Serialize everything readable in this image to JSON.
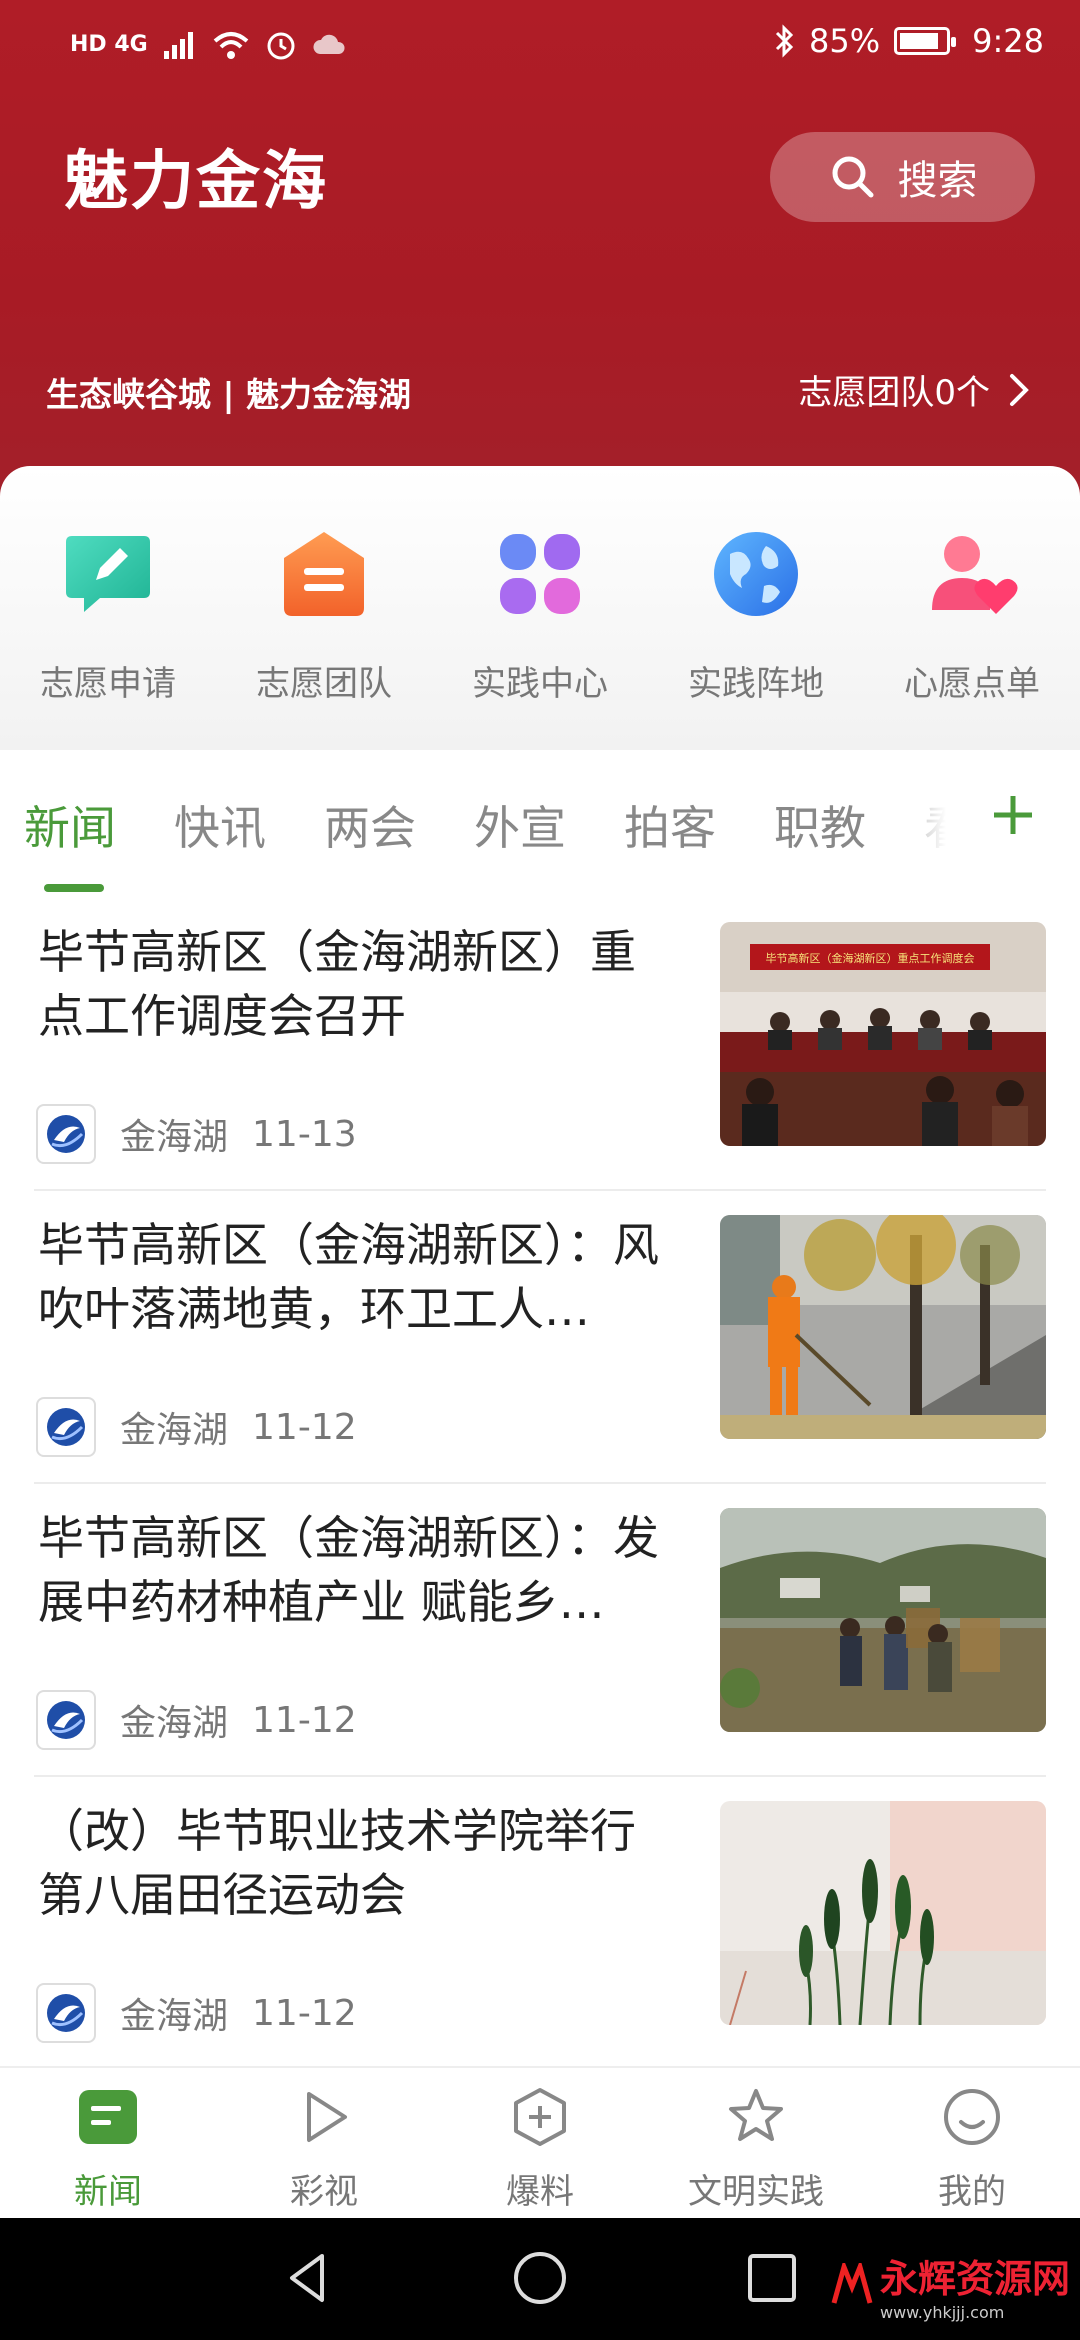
{
  "status_bar": {
    "network": "HD 4G",
    "battery": "85%",
    "battery_level": 0.85,
    "time": "9:28"
  },
  "header": {
    "title": "魅力金海",
    "search_label": "搜索",
    "slogan": "生态峡谷城 | 魅力金海湖",
    "team_count": "志愿团队0个"
  },
  "quick_actions": [
    {
      "label": "志愿申请",
      "icon": "pencil-chat-icon",
      "color": "#2ec4a6"
    },
    {
      "label": "志愿团队",
      "icon": "team-box-icon",
      "color": "#f47b3a"
    },
    {
      "label": "实践中心",
      "icon": "four-leaf-icon",
      "color": "#8a6cf0"
    },
    {
      "label": "实践阵地",
      "icon": "globe-icon",
      "color": "#3a8ff0"
    },
    {
      "label": "心愿点单",
      "icon": "person-heart-icon",
      "color": "#f2507a"
    }
  ],
  "tabs": [
    {
      "label": "新闻",
      "active": true
    },
    {
      "label": "快讯"
    },
    {
      "label": "两会"
    },
    {
      "label": "外宣"
    },
    {
      "label": "拍客"
    },
    {
      "label": "职教"
    },
    {
      "label": "看"
    }
  ],
  "news": [
    {
      "title": "毕节高新区（金海湖新区）重点工作调度会召开",
      "source": "金海湖",
      "date": "11-13",
      "thumb": "meeting-photo",
      "banner": "毕节高新区（金海湖新区）重点工作调度会"
    },
    {
      "title": "毕节高新区（金海湖新区）：风吹叶落满地黄，环卫工人…",
      "source": "金海湖",
      "date": "11-12",
      "thumb": "street-sweeper-photo"
    },
    {
      "title": "毕节高新区（金海湖新区）：发展中药材种植产业 赋能乡…",
      "source": "金海湖",
      "date": "11-12",
      "thumb": "farmers-photo"
    },
    {
      "title": "（改）毕节职业技术学院举行第八届田径运动会",
      "source": "金海湖",
      "date": "11-12",
      "thumb": "green-plants-photo"
    }
  ],
  "bottom_nav": [
    {
      "label": "新闻",
      "icon": "news-icon",
      "active": true
    },
    {
      "label": "彩视",
      "icon": "play-icon"
    },
    {
      "label": "爆料",
      "icon": "plus-hexagon-icon"
    },
    {
      "label": "文明实践",
      "icon": "star-icon"
    },
    {
      "label": "我的",
      "icon": "smile-icon"
    }
  ],
  "watermark": {
    "text": "永辉资源网",
    "url": "www.yhkjjj.com"
  },
  "colors": {
    "brand_red": "#b01d27",
    "accent_green": "#4a9a3a"
  }
}
